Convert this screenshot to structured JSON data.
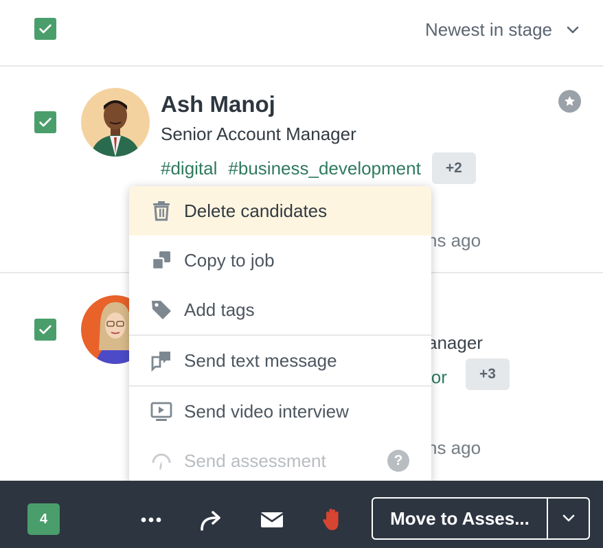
{
  "header": {
    "sort_label": "Newest in stage",
    "select_all_checked": true
  },
  "candidates": [
    {
      "name": "Ash Manoj",
      "title": "Senior Account Manager",
      "tags": [
        "#digital",
        "#business_development"
      ],
      "more_tags": "+2",
      "time_fragment": "ns ago",
      "checked": true
    },
    {
      "title_fragment": "anager",
      "tag_fragment": "ior",
      "more_tags": "+3",
      "time_fragment": "ns ago",
      "checked": true
    }
  ],
  "bulk_menu": {
    "items": [
      {
        "label": "Delete candidates",
        "icon": "trash-icon"
      },
      {
        "label": "Copy to job",
        "icon": "copy-icon"
      },
      {
        "label": "Add tags",
        "icon": "tag-icon"
      },
      {
        "label": "Send text message",
        "icon": "text-message-icon"
      },
      {
        "label": "Send video interview",
        "icon": "video-icon"
      },
      {
        "label": "Send assessment",
        "icon": "assessment-icon",
        "disabled": true
      }
    ],
    "help_glyph": "?"
  },
  "bottom_bar": {
    "selected_count": "4",
    "move_label": "Move to Asses...",
    "icons": [
      "more-icon",
      "forward-icon",
      "email-icon",
      "reject-hand-icon"
    ]
  },
  "colors": {
    "checkbox": "#4a9e6b",
    "tag_text": "#2f7a5e",
    "menu_highlight": "#fdf5e0",
    "bottom_bar": "#2d3540",
    "reject_icon": "#d64532"
  }
}
